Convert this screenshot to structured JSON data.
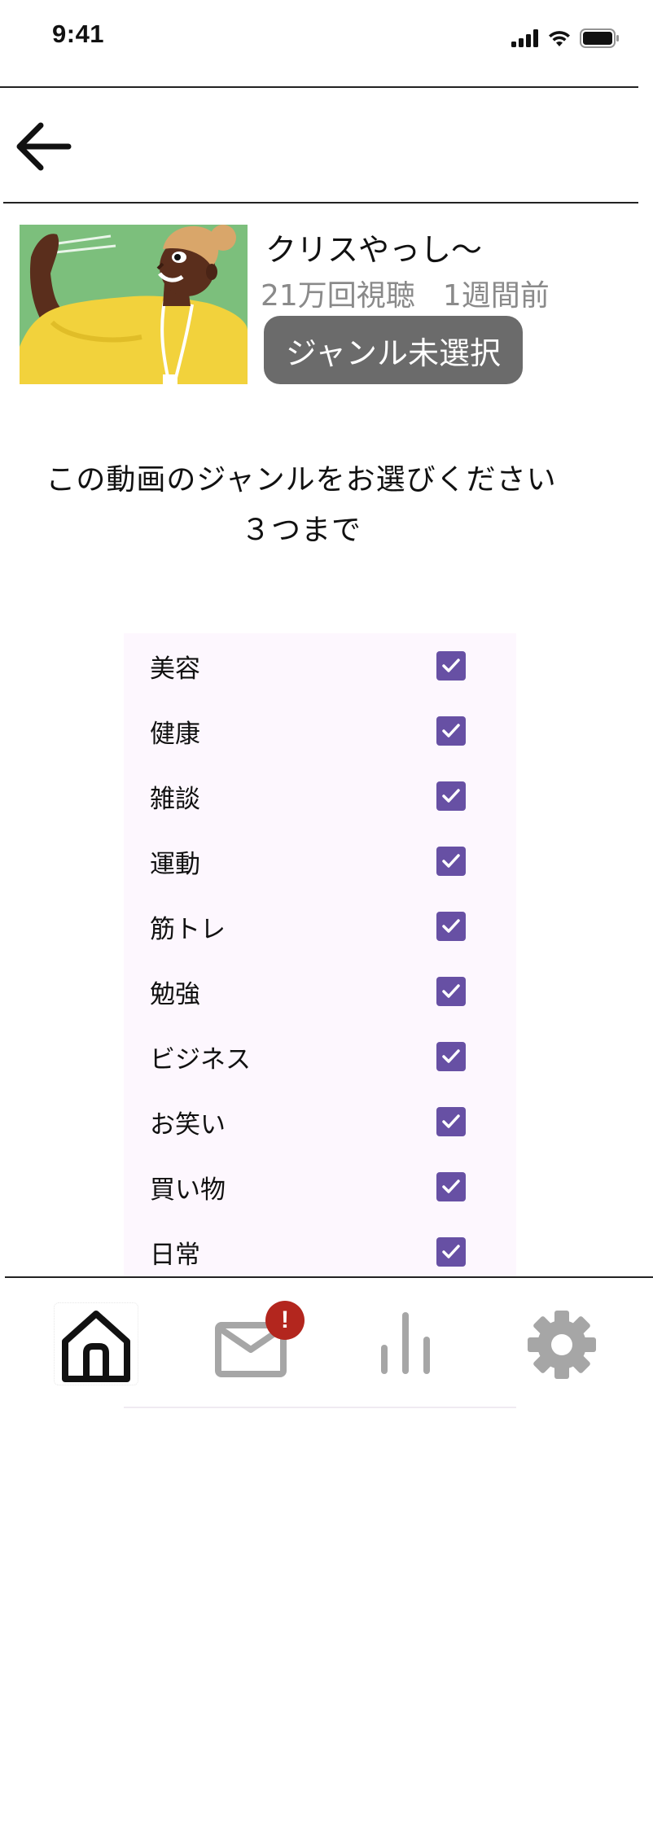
{
  "status_bar": {
    "time": "9:41"
  },
  "header": {
    "back_icon": "arrow-left-icon"
  },
  "video": {
    "title": "クリスやっし〜",
    "views": "21万回視聴",
    "posted": "1週間前",
    "genre_badge": "ジャンル未選択",
    "thumbnail_colors": {
      "background": "#7cbf7c",
      "shirt": "#f2d23c",
      "skin": "#5a2e1c"
    }
  },
  "prompt": {
    "line1": "この動画のジャンルをお選びください",
    "line2": "３つまで"
  },
  "genres": [
    {
      "label": "美容",
      "checked": true
    },
    {
      "label": "健康",
      "checked": true
    },
    {
      "label": "雑談",
      "checked": true
    },
    {
      "label": "運動",
      "checked": true
    },
    {
      "label": "筋トレ",
      "checked": true
    },
    {
      "label": "勉強",
      "checked": true
    },
    {
      "label": "ビジネス",
      "checked": true
    },
    {
      "label": "お笑い",
      "checked": true
    },
    {
      "label": "買い物",
      "checked": true
    },
    {
      "label": "日常",
      "checked": true
    }
  ],
  "bottom_nav": {
    "items": [
      {
        "icon": "home-icon",
        "active": true
      },
      {
        "icon": "mail-icon",
        "active": false
      },
      {
        "icon": "bar-chart-icon",
        "active": false
      },
      {
        "icon": "gear-icon",
        "active": false
      }
    ],
    "mail_badge": "!"
  },
  "colors": {
    "checkbox": "#6750a4",
    "list_background": "#fdf7fe",
    "badge": "#b3261e",
    "inactive_icon": "#a6a6a6",
    "genre_badge_bg": "#6b6b6b"
  }
}
